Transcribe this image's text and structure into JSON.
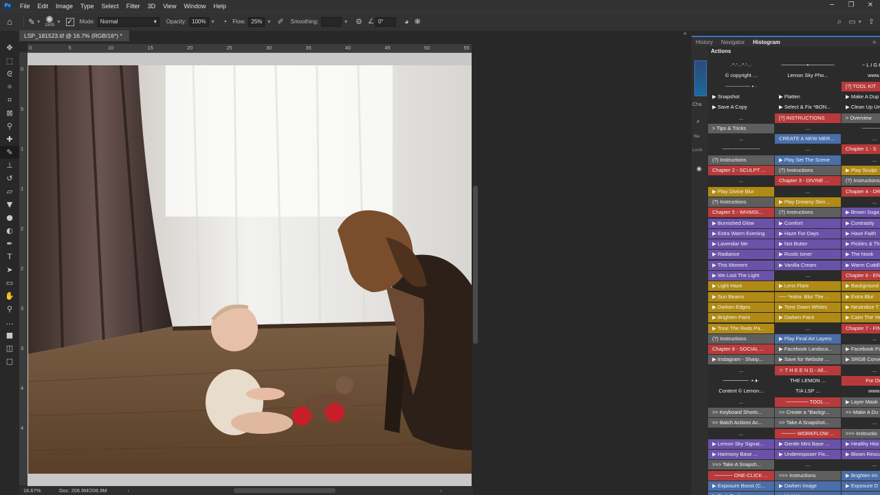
{
  "menubar": {
    "logo": "Ps",
    "items": [
      "File",
      "Edit",
      "Image",
      "Type",
      "Select",
      "Filter",
      "3D",
      "View",
      "Window",
      "Help"
    ]
  },
  "options": {
    "brush_size": "1500",
    "mode_label": "Mode:",
    "mode_value": "Normal",
    "opacity_label": "Opacity:",
    "opacity_value": "100%",
    "flow_label": "Flow:",
    "flow_value": "25%",
    "smoothing_label": "Smoothing:",
    "smoothing_value": "",
    "angle_value": "0°"
  },
  "document": {
    "tab_title": "LSP_181523.tif @ 16.7% (RGB/16*) *",
    "zoom": "16.67%",
    "doc_size": "Doc: 206.9M/206.9M",
    "hruler_ticks": [
      "0",
      "5",
      "10",
      "15",
      "20",
      "25",
      "30",
      "35",
      "40",
      "45",
      "50",
      "55"
    ],
    "vruler_ticks": [
      "0",
      "5",
      "1",
      "1",
      "2",
      "2",
      "3",
      "3",
      "4",
      "4"
    ]
  },
  "panel": {
    "tabs": [
      "History",
      "Navigator",
      "Histogram"
    ],
    "active_tab": "Histogram",
    "actions_label": "Actions",
    "side_labels": [
      "Cha",
      "Ne",
      "Lock"
    ]
  },
  "colors": {
    "gray": "#5e5e5e",
    "red": "#b93a3a",
    "blue": "#4a6ea8",
    "yellow": "#b08a14",
    "purple": "#6a52a8",
    "none": "#2b2b2b"
  },
  "actions": [
    [
      "none",
      "·°·'·.·°·'·.·",
      "none",
      "───────•───────",
      "none",
      "~ L I G H T"
    ],
    [
      "none",
      "© copyright ...",
      "none",
      "Lemon Sky Pho...",
      "none",
      "www.l"
    ],
    [
      "none",
      "┈┈┈┈┈┈┈┈ • ·",
      "none",
      "",
      "red",
      "[?]  TOOL KIT"
    ],
    [
      "none",
      "▶ Snapshot",
      "none",
      "▶ Flatten",
      "none",
      "▶ Make A Dup"
    ],
    [
      "none",
      "▶ Save A Copy",
      "none",
      "▶ Select & Fix *BON...",
      "none",
      "▶ Clean Up Un"
    ],
    [
      "none",
      "...",
      "red",
      "[?]  INSTRUCTIONS",
      "gray",
      "> Overview"
    ],
    [
      "gray",
      "> Tips & Tricks",
      "none",
      "...",
      "none",
      "┈┈┈┈┈┈┈┈"
    ],
    [
      "none",
      "...",
      "blue",
      "CREATE A NEW MER...",
      "none",
      "..."
    ],
    [
      "none",
      "┈┈┈┈┈┈┈┈┈┈┈┈",
      "none",
      "...",
      "red",
      "Chapter 1 - S"
    ],
    [
      "gray",
      "(?) Instructions",
      "blue",
      "▶ Play Set The Scene",
      "none",
      "..."
    ],
    [
      "red",
      "Chapter 2 - SCULPT ...",
      "gray",
      "(?) Instructions",
      "yellow",
      "▶ Play Sculpt"
    ],
    [
      "none",
      "...",
      "red",
      "Chapter 3 - DIVINE ...",
      "gray",
      "(?) Instructions"
    ],
    [
      "yellow",
      "▶ Play Divine Blur",
      "none",
      "...",
      "red",
      "Chapter 4 - DR"
    ],
    [
      "gray",
      "(?) Instructions",
      "yellow",
      "▶ Play Dreamy Skin ...",
      "none",
      "..."
    ],
    [
      "red",
      "Chapter 5 - WHIMSI...",
      "gray",
      "(?) Instructions",
      "purple",
      "▶ Brown Suga"
    ],
    [
      "purple",
      "▶ Burnished Glow",
      "purple",
      "▶ Comfort",
      "purple",
      "▶ Contrastiy"
    ],
    [
      "purple",
      "▶ Extra Warm Evening",
      "purple",
      "▶ Haze For Days",
      "purple",
      "▶ Have Faith"
    ],
    [
      "purple",
      "▶ Lavendar Me",
      "purple",
      "▶ Not Butter",
      "purple",
      "▶ Pickles & Th"
    ],
    [
      "purple",
      "▶ Radiance",
      "purple",
      "▶ Rustic toner",
      "purple",
      "▶ The Nook"
    ],
    [
      "purple",
      "▶ This Moment",
      "purple",
      "▶ Vanilla Cream",
      "purple",
      "▶ Warm Cuddl"
    ],
    [
      "purple",
      "▶ We Lost The Light",
      "none",
      "...",
      "red",
      "Chapter 6 - ENH"
    ],
    [
      "yellow",
      "▶ Light Haze",
      "yellow",
      "▶ Lens Flare",
      "yellow",
      "▶ Background"
    ],
    [
      "yellow",
      "▶ Sun Beams",
      "yellow",
      "── *extra: Blur The ...",
      "yellow",
      "▶ Extra Blur"
    ],
    [
      "yellow",
      "▶ Darken Edges",
      "yellow",
      "▶ Tone Down Whites",
      "yellow",
      "▶ Neutralize T"
    ],
    [
      "yellow",
      "▶ Brighten Paint",
      "yellow",
      "▶ Darken Paint",
      "yellow",
      "▶ Calm The Ye"
    ],
    [
      "yellow",
      "▶ Tone The Reds Pa...",
      "none",
      "...",
      "red",
      "Chapter 7 - FIN"
    ],
    [
      "gray",
      "(?) Instructions",
      "blue",
      "▶ Play Final Art Layers",
      "none",
      "..."
    ],
    [
      "red",
      "Chapter 8 - SOCIAL ...",
      "gray",
      "▶ Facebook Landsca...",
      "gray",
      "▶ Facebook Po"
    ],
    [
      "gray",
      "▶ Instagram - Sharp...",
      "gray",
      "▶ Save for Website ...",
      "gray",
      "▶ SRGB Conve"
    ],
    [
      "none",
      "...",
      "red",
      "☆ T H E  E N D - All...",
      "none",
      "..."
    ],
    [
      "none",
      "───────  ·•·♦·",
      "none",
      "THE LEMON ...",
      "red",
      "For Out"
    ],
    [
      "none",
      "Content © Lemon...",
      "none",
      "T/A  LSP ...",
      "none",
      "www."
    ],
    [
      "none",
      "...",
      "red",
      "──────  TOOL ...",
      "gray",
      "▶ Layer Mask"
    ],
    [
      "gray",
      ">> Keyboard Shortc...",
      "gray",
      ">> Create a \"Backgr...",
      "gray",
      ">> Make A Du"
    ],
    [
      "gray",
      ">> Batch Actions Ac...",
      "gray",
      ">> Take A Snapshot...",
      "none",
      "..."
    ],
    [
      "none",
      "...",
      "red",
      "──── WORKFLOW ...",
      "gray",
      ">>> Instructio"
    ],
    [
      "purple",
      "▶ Lemon Sky Signat...",
      "purple",
      "▶ Gentle Mini Base ...",
      "purple",
      "▶ Healthy Hist"
    ],
    [
      "purple",
      "▶ Harmony Base ...",
      "purple",
      "▶ Underexposer Fix...",
      "purple",
      "▶ Blown Rescu"
    ],
    [
      "gray",
      ">>> Take A Snapsh...",
      "none",
      "...",
      "none",
      "..."
    ],
    [
      "red",
      "─────  ONE-CLICK ...",
      "gray",
      ">>> Instructions",
      "blue",
      "▶ Brighten Im"
    ],
    [
      "blue",
      "▶ Exposure Boost (C...",
      "blue",
      "▶ Darken Image",
      "blue",
      "▶ Exposure D"
    ],
    [
      "blue",
      "▶ Dark Bodies",
      "blue",
      "▶ Mid Way",
      "blue",
      "▶ ..."
    ]
  ]
}
